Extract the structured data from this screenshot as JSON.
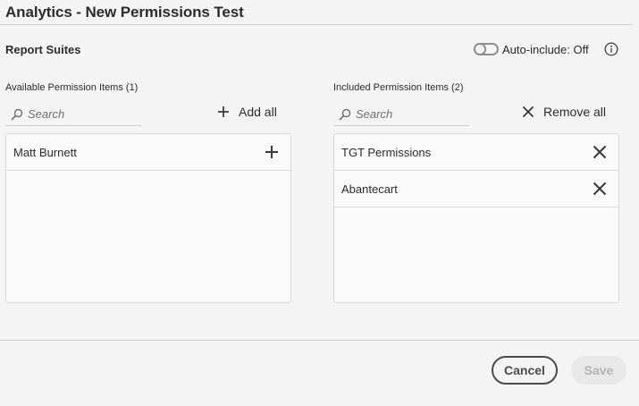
{
  "title": "Analytics - New Permissions Test",
  "section": "Report Suites",
  "auto_include": {
    "label": "Auto-include: Off",
    "enabled": false
  },
  "available": {
    "label": "Available Permission Items (1)",
    "search_placeholder": "Search",
    "action_label": "Add all",
    "items": [
      {
        "label": "Matt Burnett",
        "icon": "plus-icon"
      }
    ]
  },
  "included": {
    "label": "Included Permission Items (2)",
    "search_placeholder": "Search",
    "action_label": "Remove all",
    "items": [
      {
        "label": "TGT Permissions",
        "icon": "close-icon"
      },
      {
        "label": "Abantecart",
        "icon": "close-icon"
      }
    ]
  },
  "footer": {
    "cancel_label": "Cancel",
    "save_label": "Save",
    "save_enabled": false
  },
  "colors": {
    "text": "#2c2c2c",
    "border": "#d8d8d8",
    "background": "#f4f4f4",
    "disabled": "#b3b3b3"
  }
}
